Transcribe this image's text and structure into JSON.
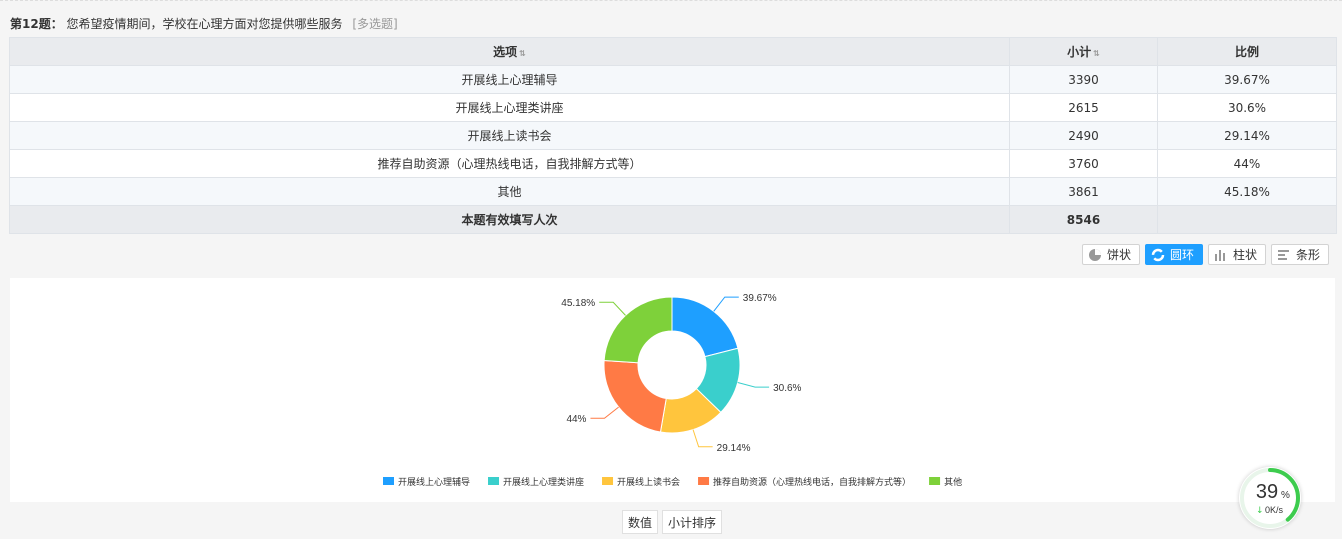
{
  "question": {
    "number": "第12题：",
    "text": "您希望疫情期间，学校在心理方面对您提供哪些服务",
    "tag": "[多选题]"
  },
  "table": {
    "headers": [
      "选项",
      "小计",
      "比例"
    ],
    "rows": [
      {
        "option": "开展线上心理辅导",
        "count": "3390",
        "percent": "39.67%"
      },
      {
        "option": "开展线上心理类讲座",
        "count": "2615",
        "percent": "30.6%"
      },
      {
        "option": "开展线上读书会",
        "count": "2490",
        "percent": "29.14%"
      },
      {
        "option": "推荐自助资源（心理热线电话，自我排解方式等）",
        "count": "3760",
        "percent": "44%"
      },
      {
        "option": "其他",
        "count": "3861",
        "percent": "45.18%"
      }
    ],
    "footer": {
      "label": "本题有效填写人次",
      "count": "8546"
    }
  },
  "chart_buttons": [
    {
      "label": "饼状",
      "icon": "pie-icon",
      "active": false
    },
    {
      "label": "圆环",
      "icon": "ring-icon",
      "active": true
    },
    {
      "label": "柱状",
      "icon": "bar-icon",
      "active": false
    },
    {
      "label": "条形",
      "icon": "hbar-icon",
      "active": false
    }
  ],
  "chart_data": {
    "type": "donut",
    "series": [
      {
        "name": "开展线上心理辅导",
        "value": 3390,
        "label": "39.67%",
        "color": "#1e9fff"
      },
      {
        "name": "开展线上心理类讲座",
        "value": 2615,
        "label": "30.6%",
        "color": "#3acfcc"
      },
      {
        "name": "开展线上读书会",
        "value": 2490,
        "label": "29.14%",
        "color": "#ffc53d"
      },
      {
        "name": "推荐自助资源（心理热线电话，自我排解方式等）",
        "value": 3760,
        "label": "44%",
        "color": "#ff7a45"
      },
      {
        "name": "其他",
        "value": 3861,
        "label": "45.18%",
        "color": "#7ed13a"
      }
    ],
    "legend_position": "bottom"
  },
  "bottom_buttons": [
    "数值",
    "小计排序"
  ],
  "widget": {
    "percent": "39",
    "percent_sign": "%",
    "speed": "0K/s",
    "progress": 0.39,
    "color": "#3dcc4e"
  }
}
